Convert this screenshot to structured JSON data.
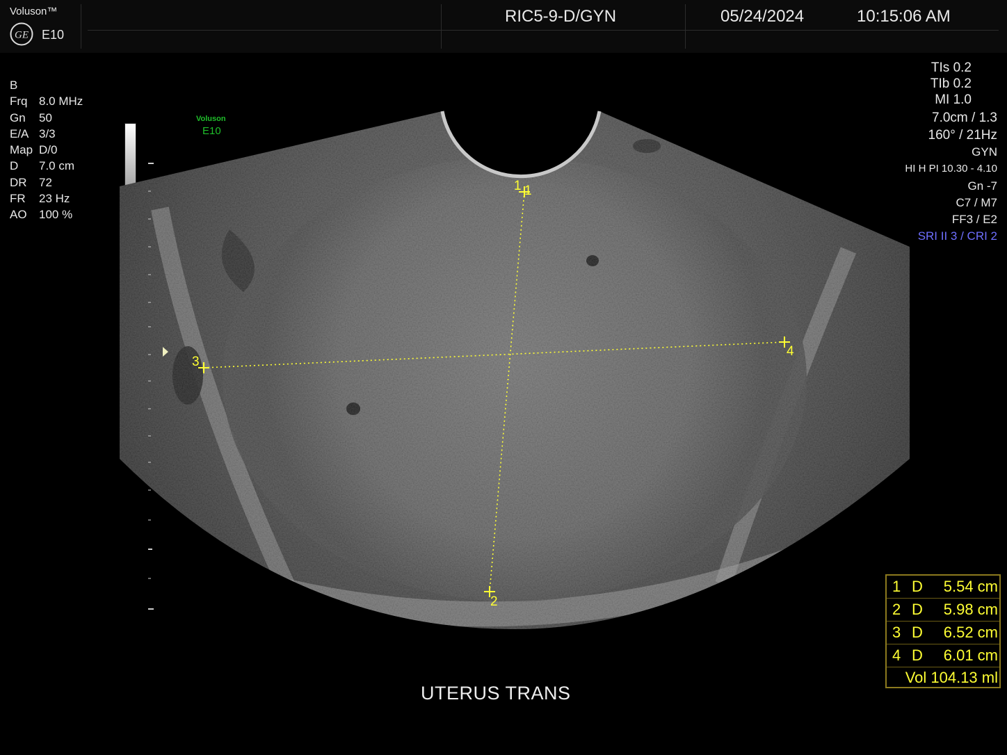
{
  "header": {
    "brand": "Voluson™",
    "model": "E10",
    "logo": "ge-logo",
    "probe": "RIC5-9-D/GYN",
    "date": "05/24/2024",
    "time": "10:15:06 AM"
  },
  "left_params": {
    "mode": "B",
    "rows": [
      {
        "key": "Frq",
        "value": "8.0 MHz"
      },
      {
        "key": "Gn",
        "value": "50"
      },
      {
        "key": "E/A",
        "value": "3/3"
      },
      {
        "key": "Map",
        "value": "D/0"
      },
      {
        "key": "D",
        "value": "7.0 cm"
      },
      {
        "key": "DR",
        "value": "72"
      },
      {
        "key": "FR",
        "value": "23 Hz"
      },
      {
        "key": "AO",
        "value": "100 %"
      }
    ]
  },
  "right_params": {
    "tis": "TIs  0.2",
    "tib": "TIb  0.2",
    "mi": "MI  1.0",
    "depth": "7.0cm / 1.3",
    "angle": "160° / 21Hz",
    "preset": "GYN",
    "harmonic": "HI H PI 10.30 - 4.10",
    "gain": "Gn  -7",
    "cm": "C7 / M7",
    "ff": "FF3 / E2",
    "sri": "SRI II 3 / CRI 2",
    "sri_color": "#6f6fff"
  },
  "image_watermark": {
    "line1": "Voluson",
    "line2": "E10",
    "color": "#1fbf2a"
  },
  "calipers": {
    "color": "#ffff33",
    "labels": [
      "1",
      "1",
      "2",
      "3",
      "4"
    ]
  },
  "measurements": {
    "rows": [
      {
        "n": "1",
        "type": "D",
        "value": "5.54 cm"
      },
      {
        "n": "2",
        "type": "D",
        "value": "5.98 cm"
      },
      {
        "n": "3",
        "type": "D",
        "value": "6.52 cm"
      },
      {
        "n": "4",
        "type": "D",
        "value": "6.01 cm"
      }
    ],
    "volume": "Vol  104.13 ml"
  },
  "caption": "UTERUS  TRANS"
}
